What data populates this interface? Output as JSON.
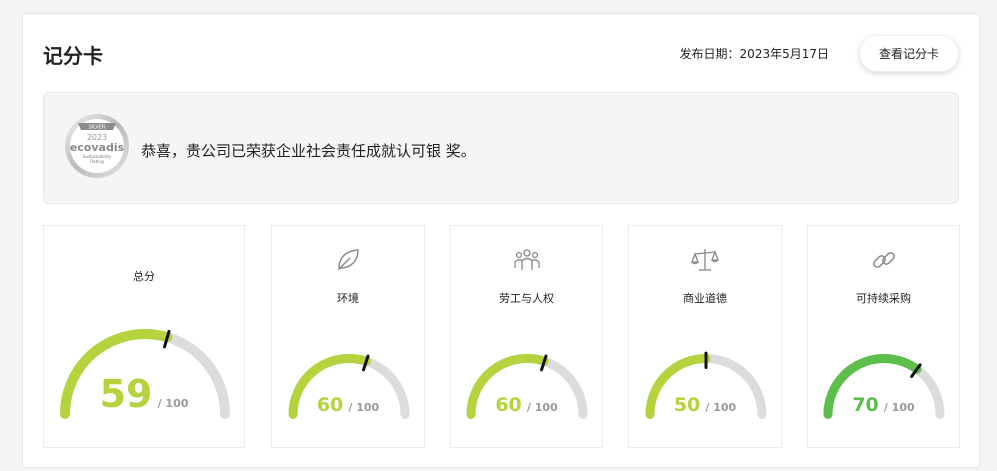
{
  "header": {
    "title": "记分卡",
    "publish_date": "发布日期：2023年5月17日",
    "view_button": "查看记分卡"
  },
  "banner": {
    "badge": {
      "tier": "SILVER",
      "year": "2023",
      "brand": "ecovadis",
      "subtitle1": "Sustainability",
      "subtitle2": "Rating"
    },
    "message": "恭喜，贵公司已荣获企业社会责任成就认可银 奖。"
  },
  "colors": {
    "accent_green_light": "#b5d33d",
    "accent_green": "#5cbf4c",
    "track_gray": "#dcdcdc",
    "needle": "#111111"
  },
  "scores": [
    {
      "label": "总分",
      "score": 59,
      "max": "/ 100",
      "icon": "none",
      "color": "#b5d33d"
    },
    {
      "label": "环境",
      "score": 60,
      "max": "/ 100",
      "icon": "leaf-icon",
      "color": "#b5d33d"
    },
    {
      "label": "劳工与人权",
      "score": 60,
      "max": "/ 100",
      "icon": "people-icon",
      "color": "#b5d33d"
    },
    {
      "label": "商业道德",
      "score": 50,
      "max": "/ 100",
      "icon": "scales-icon",
      "color": "#b5d33d"
    },
    {
      "label": "可持续采购",
      "score": 70,
      "max": "/ 100",
      "icon": "chain-link-icon",
      "color": "#5cbf4c"
    }
  ]
}
